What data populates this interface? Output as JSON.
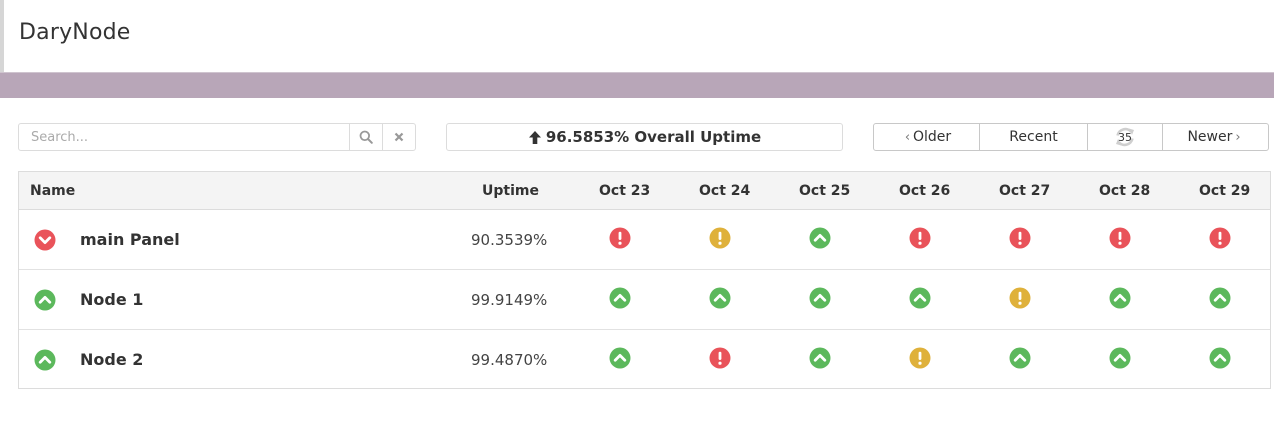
{
  "app": {
    "title": "DaryNode"
  },
  "colors": {
    "up": "#5cb85c",
    "down": "#e9535a",
    "warn": "#dfb13b",
    "band": "#b8a6b8"
  },
  "toolbar": {
    "search_placeholder": "Search...",
    "search_icon": "search-icon",
    "clear_icon": "close-icon",
    "overall_uptime": "96.5853% Overall Uptime",
    "older_label": "Older",
    "recent_label": "Recent",
    "refresh_count": "35",
    "newer_label": "Newer"
  },
  "table": {
    "headers": {
      "name": "Name",
      "uptime": "Uptime"
    },
    "days": [
      "Oct 23",
      "Oct 24",
      "Oct 25",
      "Oct 26",
      "Oct 27",
      "Oct 28",
      "Oct 29"
    ],
    "rows": [
      {
        "name": "main Panel",
        "status": "down",
        "uptime": "90.3539%",
        "days": [
          "down",
          "warn",
          "up",
          "down",
          "down",
          "down",
          "down"
        ]
      },
      {
        "name": "Node 1",
        "status": "up",
        "uptime": "99.9149%",
        "days": [
          "up",
          "up",
          "up",
          "up",
          "warn",
          "up",
          "up"
        ]
      },
      {
        "name": "Node 2",
        "status": "up",
        "uptime": "99.4870%",
        "days": [
          "up",
          "down",
          "up",
          "warn",
          "up",
          "up",
          "up"
        ]
      }
    ]
  }
}
